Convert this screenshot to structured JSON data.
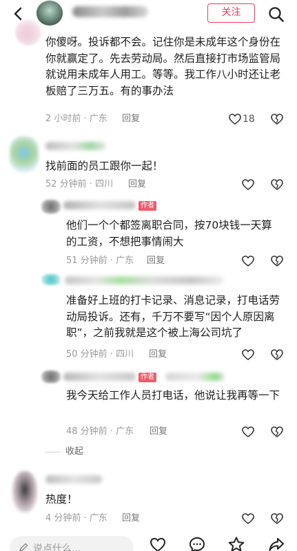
{
  "header": {
    "follow_label": "关注"
  },
  "comments": [
    {
      "text": "你傻呀。投诉都不会。记住你是未成年这个身份在你就赢定了。先去劳动局。然后直接打市场监管局就说用未成年人用工。等等。我工作八小时还让老板赔了三万五。有的事办法",
      "meta": "2 小时前 · 广东",
      "reply": "回复",
      "likes": "18"
    },
    {
      "text": "找前面的员工跟你一起！",
      "meta": "52 分钟前 · 四川",
      "reply": "回复"
    },
    {
      "badge": "作者",
      "text": "他们一个个都签离职合同，按70块钱一天算的工资，不想把事情闹大",
      "meta": "51 分钟前 · 广东",
      "reply": "回复"
    },
    {
      "text": "准备好上班的打卡记录、消息记录，打电话劳动局投诉。还有，千万不要写“因个人原因离职”，之前我就是这个被上海公司坑了",
      "meta": "50 分钟前 · 四川",
      "reply": "回复"
    },
    {
      "badge": "作者",
      "text": "我今天给工作人员打电话，他说让我再等一下",
      "meta": "48 分钟前 · 广东",
      "reply": "回复"
    },
    {
      "text": "热度！",
      "meta": "4 分钟前 · 广东",
      "reply": "回复"
    }
  ],
  "collapse_label": "收起",
  "bottom_bar": {
    "input_placeholder": "说点什么..."
  },
  "icons": [
    "back-arrow-icon",
    "search-icon",
    "heart-icon",
    "dislike-heart-icon",
    "pen-icon",
    "comment-icon",
    "star-icon",
    "share-icon"
  ],
  "colors": {
    "accent": "#ee3c5a",
    "meta_text": "#9a9a9a",
    "badge": "#f15a6a"
  }
}
